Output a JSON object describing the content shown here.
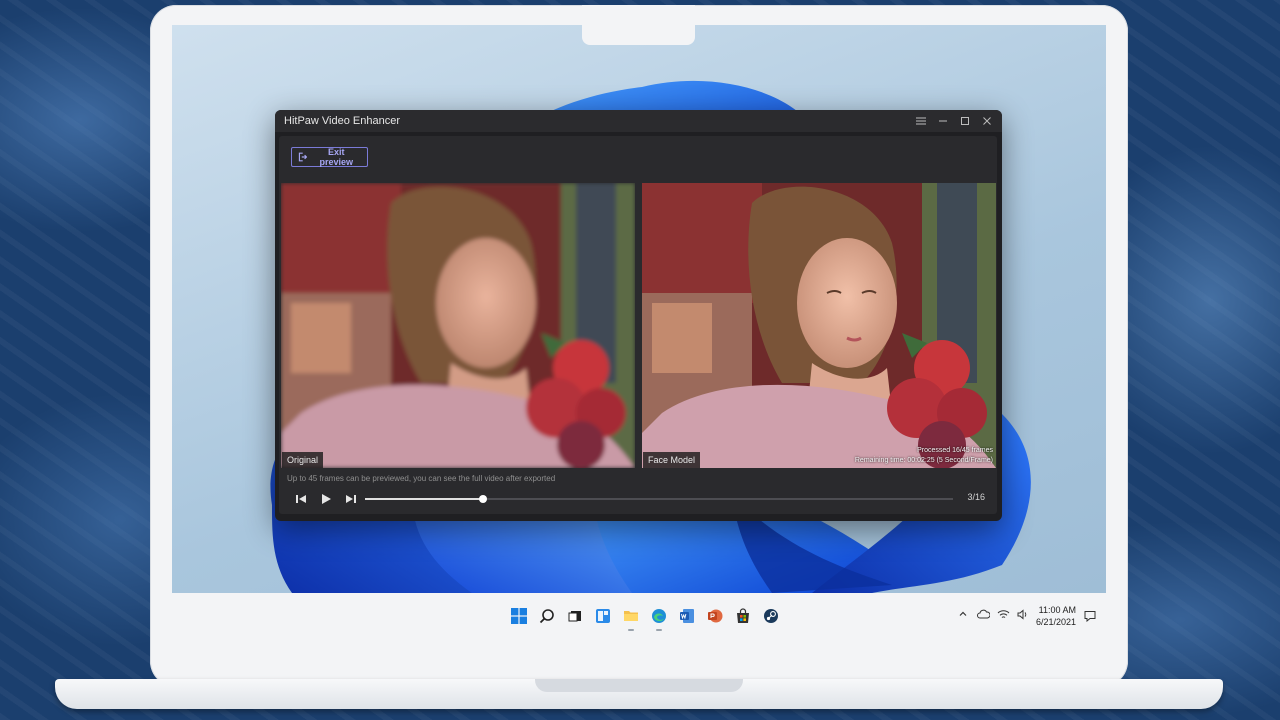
{
  "window": {
    "title": "HitPaw Video Enhancer",
    "controls": [
      "menu-icon",
      "minimize-icon",
      "maximize-icon",
      "close-icon"
    ]
  },
  "toolbar": {
    "exit_preview_label": "Exit preview"
  },
  "panes": {
    "left_label": "Original",
    "right_label": "Face Model"
  },
  "progress": {
    "processed": "Processed 16/45 frames",
    "remaining": "Remaining time: 00:02:25 (5 Second/Frame)"
  },
  "hint": "Up to 45 frames can be previewed, you can see the full video after exported",
  "playback": {
    "counter": "3/16",
    "position": 0.2
  },
  "taskbar": {
    "apps": [
      "windows-start-icon",
      "search-icon",
      "task-view-icon",
      "widgets-icon",
      "file-explorer-icon",
      "edge-icon",
      "word-icon",
      "powerpoint-icon",
      "store-icon",
      "steam-icon"
    ]
  },
  "tray": {
    "icons": [
      "chevron-up-icon",
      "cloud-icon",
      "wifi-icon",
      "volume-icon"
    ],
    "time": "11:00 AM",
    "date": "6/21/2021"
  },
  "colors": {
    "accent": "#7b7bd8",
    "window_bg": "#1f1f22",
    "taskbar_bg": "#f3f4f6"
  }
}
